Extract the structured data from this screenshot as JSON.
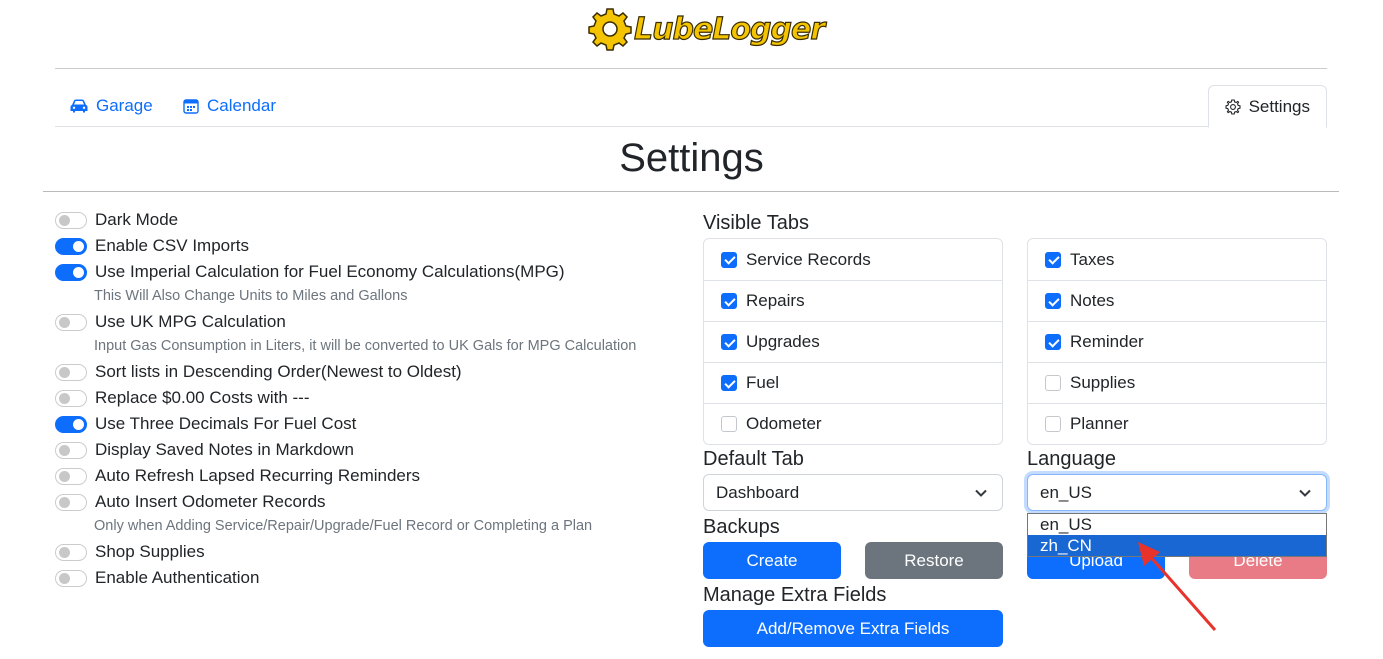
{
  "header": {
    "logo_text": "LubeLogger"
  },
  "nav": {
    "garage": "Garage",
    "calendar": "Calendar",
    "settings": "Settings"
  },
  "page_title": "Settings",
  "toggles": [
    {
      "label": "Dark Mode",
      "on": false
    },
    {
      "label": "Enable CSV Imports",
      "on": true
    },
    {
      "label": "Use Imperial Calculation for Fuel Economy Calculations(MPG)",
      "on": true,
      "hint": "This Will Also Change Units to Miles and Gallons"
    },
    {
      "label": "Use UK MPG Calculation",
      "on": false,
      "hint": "Input Gas Consumption in Liters, it will be converted to UK Gals for MPG Calculation"
    },
    {
      "label": "Sort lists in Descending Order(Newest to Oldest)",
      "on": false
    },
    {
      "label": "Replace $0.00 Costs with ---",
      "on": false
    },
    {
      "label": "Use Three Decimals For Fuel Cost",
      "on": true
    },
    {
      "label": "Display Saved Notes in Markdown",
      "on": false
    },
    {
      "label": "Auto Refresh Lapsed Recurring Reminders",
      "on": false
    },
    {
      "label": "Auto Insert Odometer Records",
      "on": false,
      "hint": "Only when Adding Service/Repair/Upgrade/Fuel Record or Completing a Plan"
    },
    {
      "label": "Shop Supplies",
      "on": false
    },
    {
      "label": "Enable Authentication",
      "on": false
    }
  ],
  "visible_tabs": {
    "label": "Visible Tabs",
    "left": [
      {
        "label": "Service Records",
        "checked": true
      },
      {
        "label": "Repairs",
        "checked": true
      },
      {
        "label": "Upgrades",
        "checked": true
      },
      {
        "label": "Fuel",
        "checked": true
      },
      {
        "label": "Odometer",
        "checked": false
      }
    ],
    "right": [
      {
        "label": "Taxes",
        "checked": true
      },
      {
        "label": "Notes",
        "checked": true
      },
      {
        "label": "Reminder",
        "checked": true
      },
      {
        "label": "Supplies",
        "checked": false
      },
      {
        "label": "Planner",
        "checked": false
      }
    ]
  },
  "default_tab": {
    "label": "Default Tab",
    "value": "Dashboard"
  },
  "language": {
    "label": "Language",
    "value": "en_US",
    "options": [
      "en_US",
      "zh_CN"
    ],
    "highlighted": "zh_CN"
  },
  "backups": {
    "label": "Backups",
    "create": "Create",
    "restore": "Restore",
    "upload": "Upload",
    "delete": "Delete"
  },
  "extra_fields": {
    "label": "Manage Extra Fields",
    "button": "Add/Remove Extra Fields"
  },
  "colors": {
    "primary": "#0d6efd",
    "secondary": "#6c757d",
    "danger": "#dc3545",
    "dropdown_highlight": "#1967d2",
    "annotation_arrow": "#e8322c"
  }
}
